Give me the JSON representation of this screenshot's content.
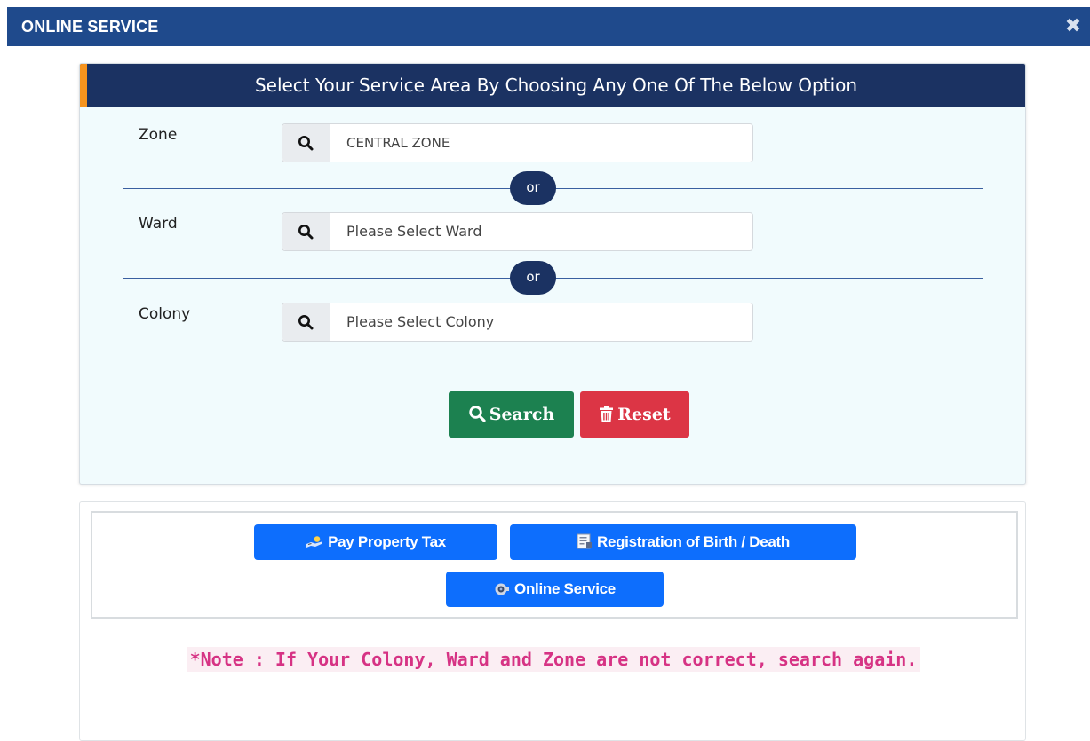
{
  "window": {
    "title": "ONLINE SERVICE",
    "close_glyph": "✖"
  },
  "area_selector": {
    "heading": "Select Your Service Area By Choosing Any One Of The Below Option",
    "separator_text": "or",
    "fields": {
      "zone": {
        "label": "Zone",
        "value": "CENTRAL ZONE"
      },
      "ward": {
        "label": "Ward",
        "placeholder": "Please Select Ward"
      },
      "colony": {
        "label": "Colony",
        "placeholder": "Please Select Colony"
      }
    },
    "search_label": "Search",
    "reset_label": "Reset"
  },
  "quick_links": {
    "pay_property_tax": "Pay Property Tax",
    "registration": "Registration of Birth / Death",
    "online_service": "Online Service"
  },
  "note": "*Note : If Your Colony, Ward and Zone are not correct, search again.",
  "colors": {
    "titlebar": "#1f4a8c",
    "header": "#1b3262",
    "accent": "#f7941d",
    "search": "#1c8150",
    "reset": "#dc3545",
    "link_button": "#0d6efd",
    "note": "#d63384"
  }
}
